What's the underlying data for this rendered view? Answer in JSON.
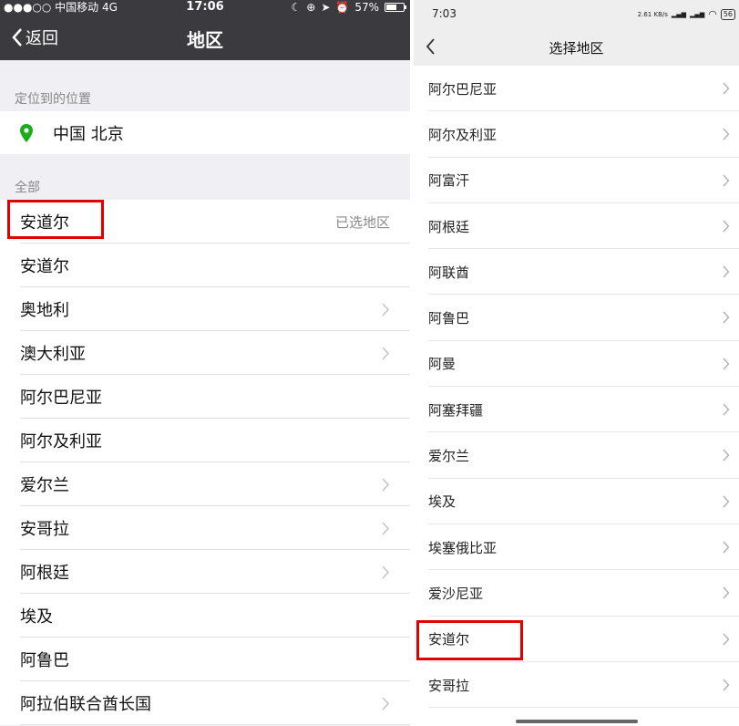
{
  "left": {
    "status": {
      "carrier": "●●●○○ 中国移动  4G",
      "time": "17:06",
      "battery": "57%"
    },
    "nav": {
      "back_label": "返回",
      "title": "地区"
    },
    "location_header": "定位到的位置",
    "location_value": "中国 北京",
    "all_header": "全部",
    "rows": [
      {
        "label": "安道尔",
        "hint": "已选地区"
      },
      {
        "label": "安道尔"
      },
      {
        "label": "奥地利"
      },
      {
        "label": "澳大利亚"
      },
      {
        "label": "阿尔巴尼亚"
      },
      {
        "label": "阿尔及利亚"
      },
      {
        "label": "爱尔兰"
      },
      {
        "label": "安哥拉"
      },
      {
        "label": "阿根廷"
      },
      {
        "label": "埃及"
      },
      {
        "label": "阿鲁巴"
      },
      {
        "label": "阿拉伯联合酋长国"
      }
    ]
  },
  "right": {
    "status": {
      "time": "7:03",
      "net_speed": "2.61 KB/s",
      "battery": "56"
    },
    "nav": {
      "title": "选择地区"
    },
    "rows": [
      "阿尔巴尼亚",
      "阿尔及利亚",
      "阿富汗",
      "阿根廷",
      "阿联酋",
      "阿鲁巴",
      "阿曼",
      "阿塞拜疆",
      "爱尔兰",
      "埃及",
      "埃塞俄比亚",
      "爱沙尼亚",
      "安道尔",
      "安哥拉"
    ]
  },
  "colors": {
    "highlight": "#e10000",
    "location_pin": "#1aad19",
    "ios_bar": "#3b3a3f",
    "android_bar": "#eeeeee"
  }
}
